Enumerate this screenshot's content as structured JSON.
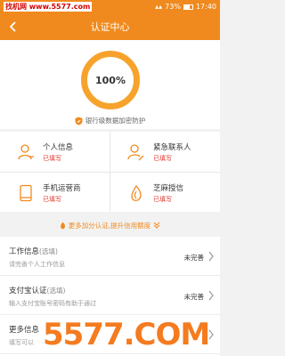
{
  "status_bar": {
    "watermark": "找机网 www.5577.com",
    "battery": "73%",
    "time": "17:40",
    "accent_color": "#f08a1e"
  },
  "nav": {
    "title": "认证中心"
  },
  "hero": {
    "progress_text": "100%",
    "progress_value": 1.0,
    "secure_text": "银行级数据加密防护",
    "secure_icon": "shield-icon"
  },
  "cards": [
    {
      "name": "个人信息",
      "status": "已填写",
      "icon": "person-icon"
    },
    {
      "name": "紧急联系人",
      "status": "已填写",
      "icon": "contact-edit-icon"
    },
    {
      "name": "手机运营商",
      "status": "已填写",
      "icon": "phone-icon"
    },
    {
      "name": "芝麻授信",
      "status": "已填写",
      "icon": "sesame-icon"
    }
  ],
  "more_auth": {
    "label": "更多加分认证,提升信用额度"
  },
  "list": [
    {
      "title": "工作信息",
      "optional": "(选填)",
      "subtitle": "请完善个人工作信息",
      "status": "未完善"
    },
    {
      "title": "支付宝认证",
      "optional": "(选填)",
      "subtitle": "输入支付宝账号密码有助于通过",
      "status": "未完善"
    },
    {
      "title": "更多信息",
      "optional": "",
      "subtitle": "填写可以",
      "status": ""
    }
  ],
  "overlay": {
    "logo_text": "5577.COM"
  }
}
